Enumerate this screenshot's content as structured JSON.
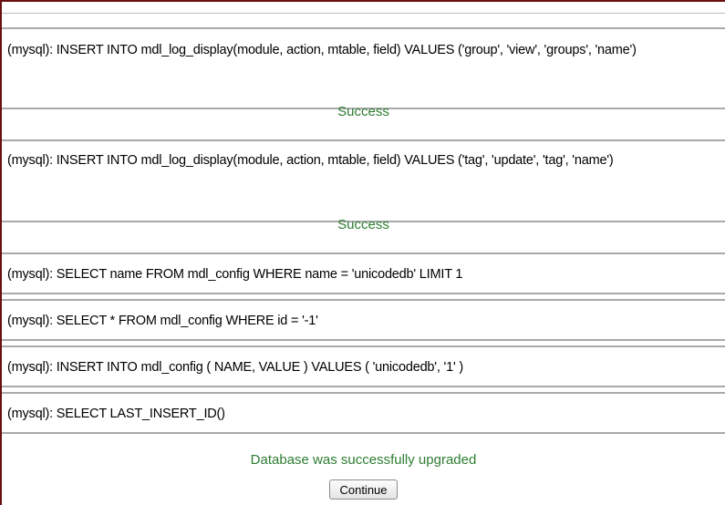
{
  "queries": [
    "(mysql): INSERT INTO mdl_log_display(module, action, mtable, field) VALUES ('group', 'view', 'groups', 'name')",
    "(mysql): INSERT INTO mdl_log_display(module, action, mtable, field) VALUES ('tag', 'update', 'tag', 'name')",
    "(mysql): SELECT name FROM mdl_config WHERE name = 'unicodedb' LIMIT 1",
    "(mysql): SELECT * FROM mdl_config WHERE id = '-1'",
    "(mysql): INSERT INTO mdl_config ( NAME, VALUE ) VALUES ( 'unicodedb', '1' )",
    "(mysql): SELECT LAST_INSERT_ID()"
  ],
  "status": {
    "success_label": "Success",
    "final_message": "Database was successfully upgraded"
  },
  "actions": {
    "continue_label": "Continue"
  },
  "colors": {
    "success_text": "#2e7d32",
    "frame_border": "#6b0f0f",
    "box_border": "#a9a9a9"
  }
}
